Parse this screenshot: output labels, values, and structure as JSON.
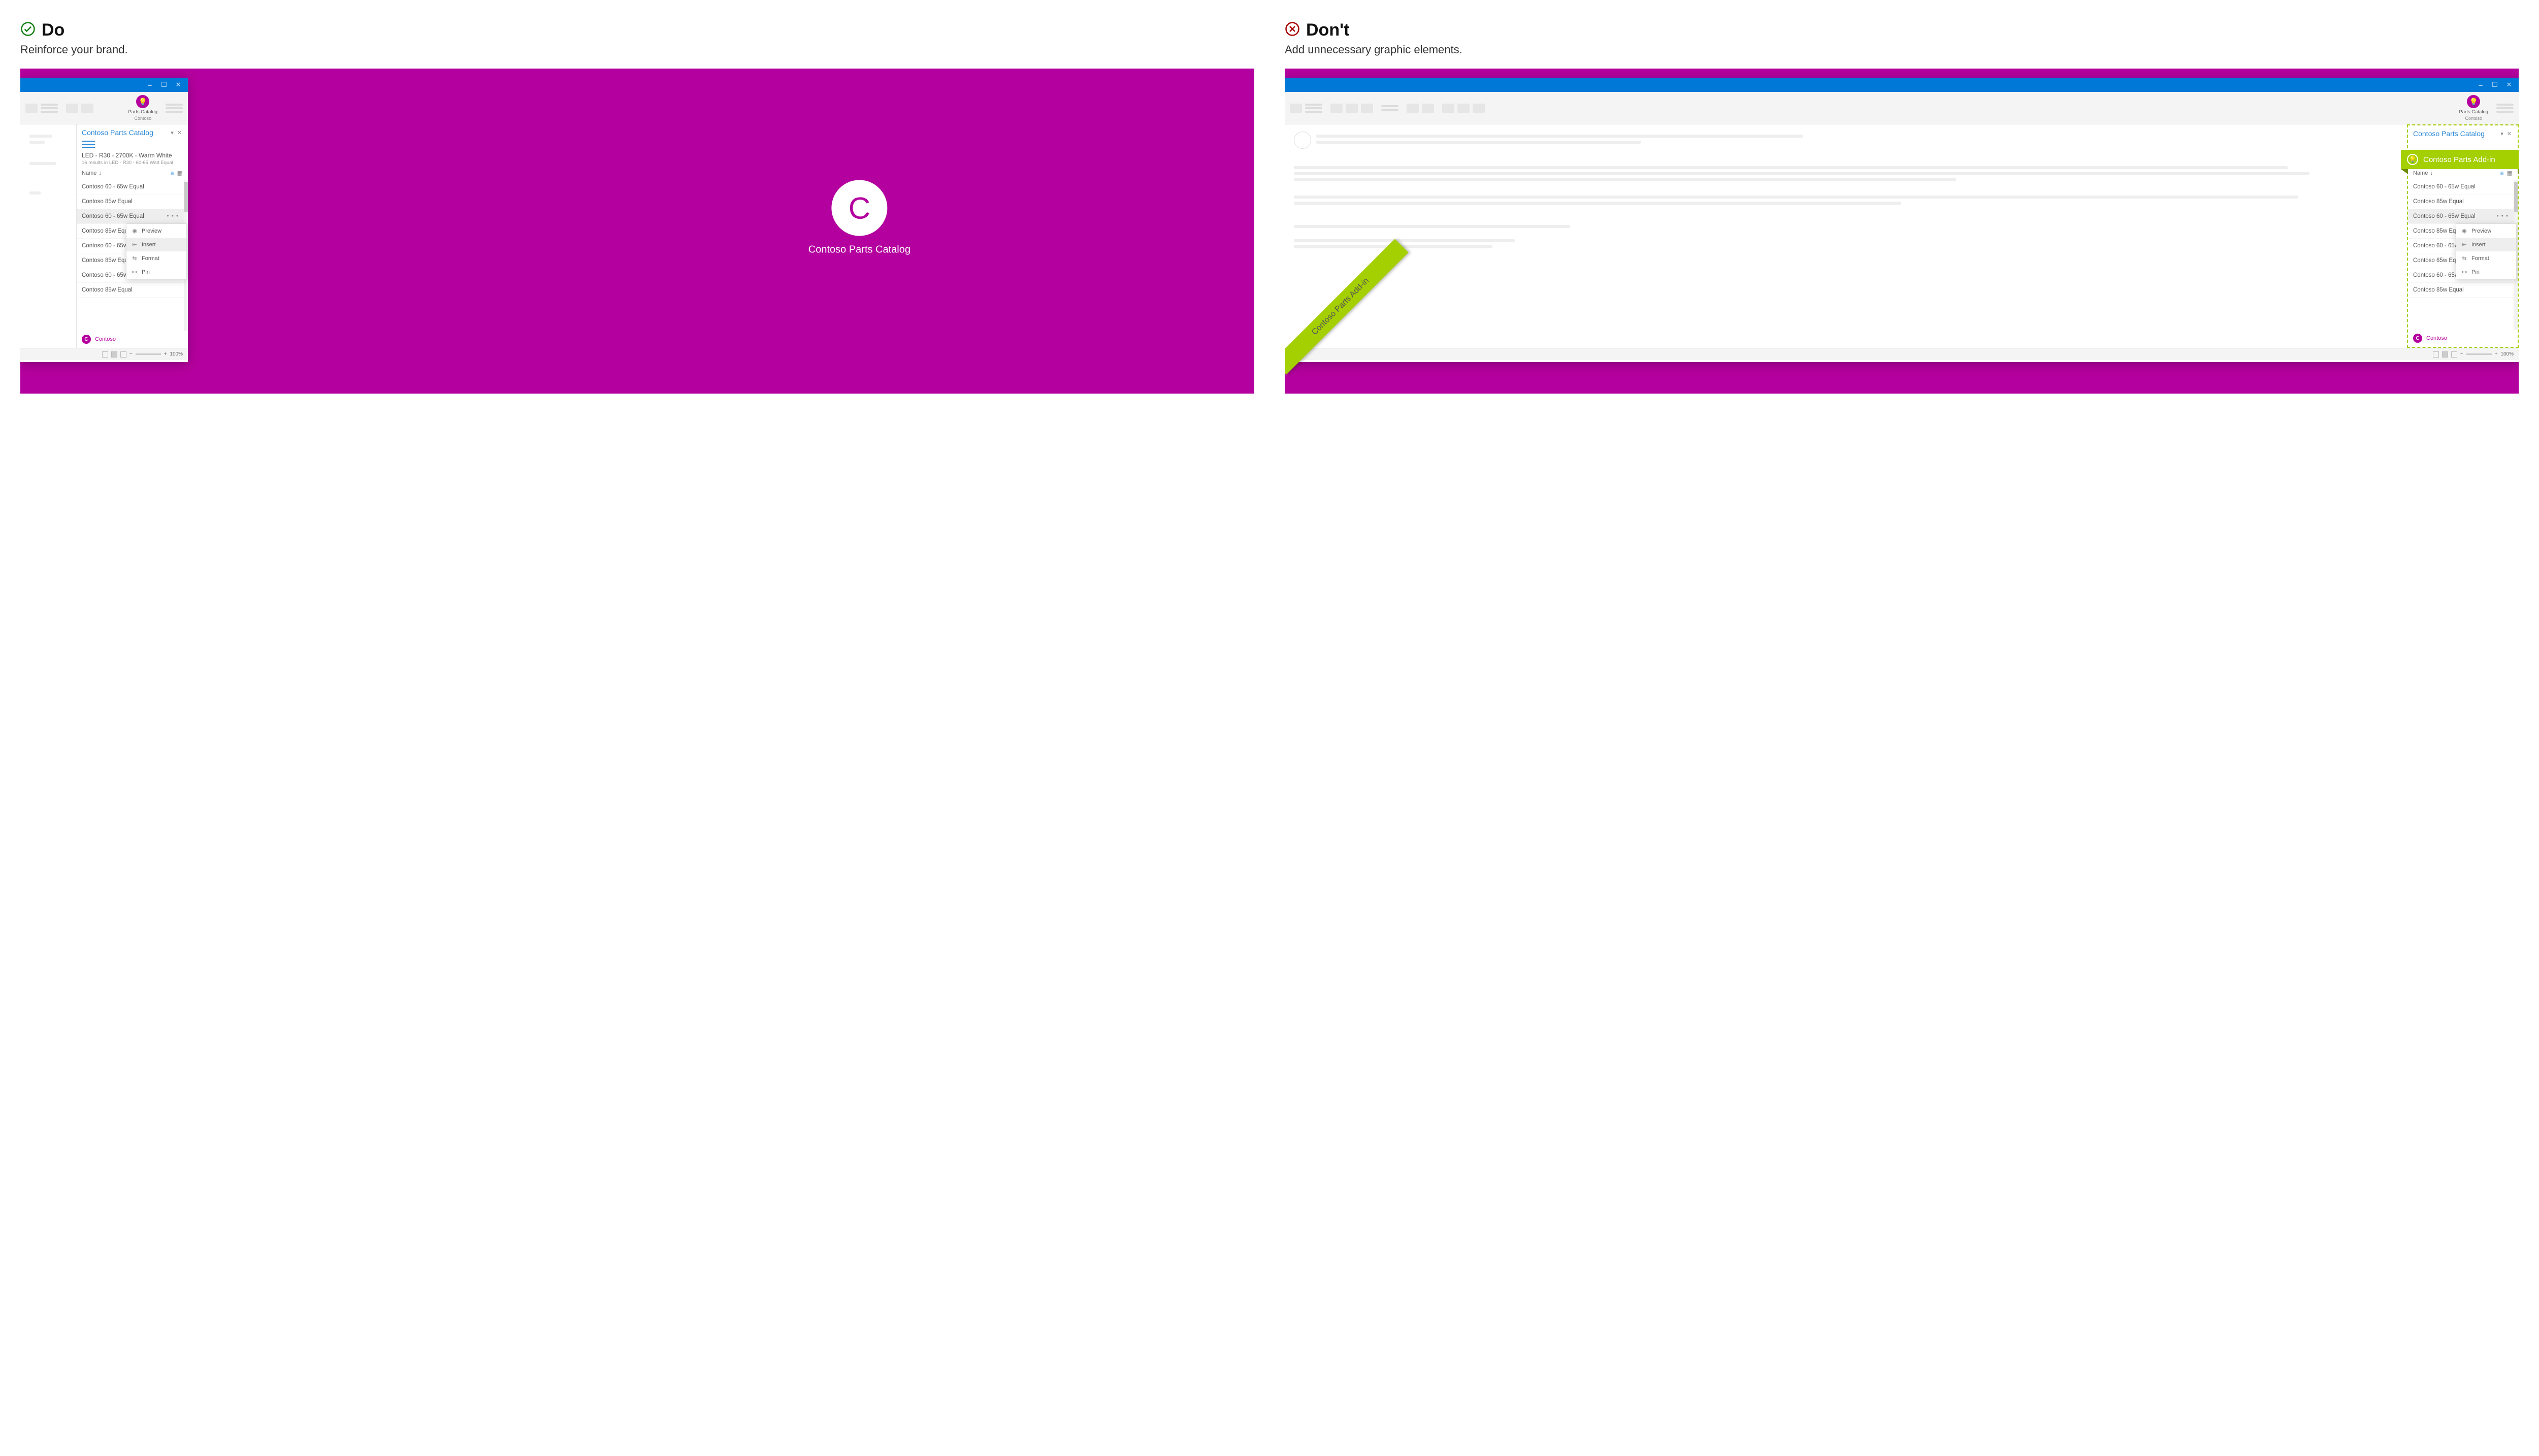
{
  "do": {
    "heading": "Do",
    "subheading": "Reinforce your brand."
  },
  "dont": {
    "heading": "Don't",
    "subheading": "Add unnecessary graphic elements.",
    "banner": "Contoso Parts Add-in",
    "sash": "Contoso Parts Add-in"
  },
  "ribbon_button": {
    "line1": "Parts Catalog",
    "line2": "Contoso"
  },
  "pane": {
    "title": "Contoso Parts Catalog",
    "crumb": "LED - R30 - 2700K - Warm White",
    "crumb_sub": "16 results in LED - R30 - 60-65 Watt Equal",
    "name_header": "Name",
    "items": [
      "Contoso 60 - 65w Equal",
      "Contoso 85w Equal",
      "Contoso 60 - 65w Equal",
      "Contoso 85w Equal",
      "Contoso 60 - 65w Equal",
      "Contoso 85w Equal",
      "Contoso 60 - 65w Equal",
      "Contoso 85w Equal"
    ],
    "selected_index": 2,
    "footer_brand": "Contoso",
    "footer_badge": "C"
  },
  "context_menu": {
    "preview": "Preview",
    "insert": "Insert",
    "format": "Format",
    "pin": "Pin"
  },
  "statusbar": {
    "zoom": "100%"
  },
  "brand": {
    "letter": "C",
    "name": "Contoso Parts Catalog"
  },
  "window_controls": {
    "min": "–",
    "max": "☐",
    "close": "✕"
  }
}
